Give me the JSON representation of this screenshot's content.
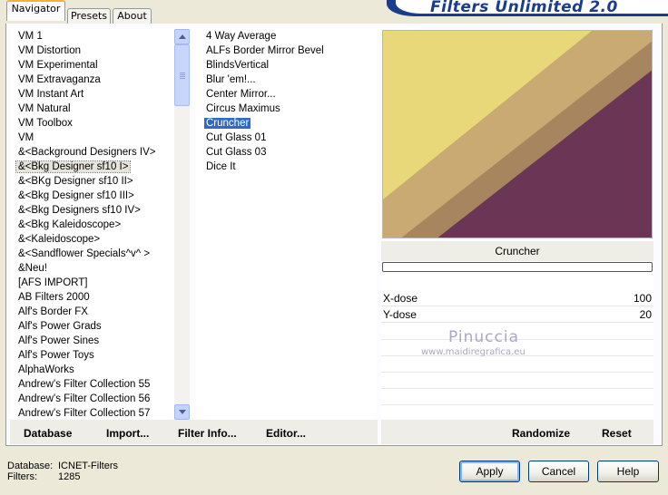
{
  "banner": {
    "title": "Filters Unlimited 2.0"
  },
  "tabs": [
    {
      "label": "Navigator"
    },
    {
      "label": "Presets"
    },
    {
      "label": "About"
    }
  ],
  "categories": [
    "VM 1",
    "VM Distortion",
    "VM Experimental",
    "VM Extravaganza",
    "VM Instant Art",
    "VM Natural",
    "VM Toolbox",
    "VM",
    "&<Background Designers IV>",
    "&<Bkg Designer sf10 I>",
    "&<BKg Designer sf10 II>",
    "&<Bkg Designer sf10 III>",
    "&<Bkg Designers sf10 IV>",
    "&<Bkg Kaleidoscope>",
    "&<Kaleidoscope>",
    "&<Sandflower Specials^v^ >",
    "&Neu!",
    "[AFS IMPORT]",
    "AB Filters 2000",
    "Alf's Border FX",
    "Alf's Power Grads",
    "Alf's Power Sines",
    "Alf's Power Toys",
    "AlphaWorks",
    "Andrew's Filter Collection 55",
    "Andrew's Filter Collection 56",
    "Andrew's Filter Collection 57"
  ],
  "filters": [
    "4 Way Average",
    "ALFs Border Mirror Bevel",
    "BlindsVertical",
    "Blur 'em!...",
    "Center Mirror...",
    "Circus Maximus",
    "Cruncher",
    "Cut Glass  01",
    "Cut Glass  03",
    "Dice It"
  ],
  "selected_category_index": 9,
  "selected_filter_index": 6,
  "filter_panel": {
    "name": "Cruncher",
    "progress": 0,
    "sliders": [
      {
        "label": "X-dose",
        "value": "100"
      },
      {
        "label": "Y-dose",
        "value": "20"
      }
    ]
  },
  "preview_colors": {
    "yellow": "#e8d87a",
    "tan_light": "#c8aa72",
    "tan": "#a7855f",
    "plum": "#6b3556"
  },
  "footer_buttons": {
    "database": "Database",
    "import": "Import...",
    "filter_info": "Filter Info...",
    "editor": "Editor...",
    "randomize": "Randomize",
    "reset": "Reset"
  },
  "info": {
    "database_label": "Database:",
    "database_value": "ICNET-Filters",
    "filters_label": "Filters:",
    "filters_value": "1285"
  },
  "dialog_buttons": {
    "apply": "Apply",
    "cancel": "Cancel",
    "help": "Help"
  },
  "watermark": {
    "name": "Pinuccia",
    "url": "www.maidiregrafica.eu"
  }
}
